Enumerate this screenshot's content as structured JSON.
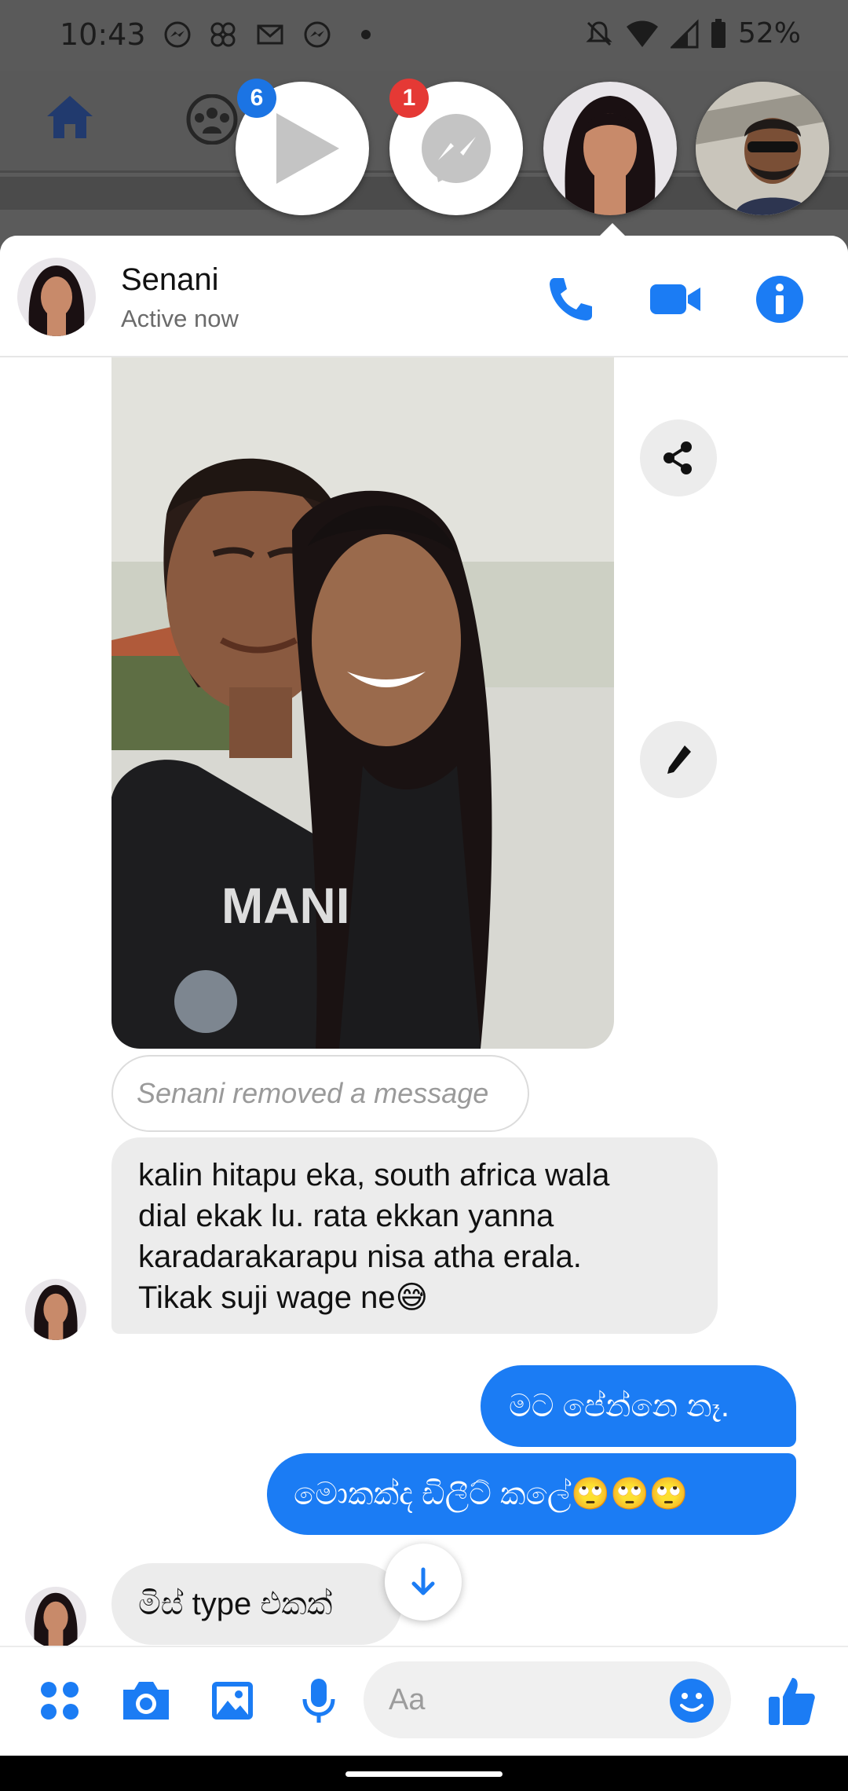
{
  "status_bar": {
    "time": "10:43",
    "battery": "52%",
    "icons": [
      "messenger-icon",
      "grid-icon",
      "mail-icon",
      "messenger-icon",
      "dot-icon"
    ],
    "right_icons": [
      "mute-icon",
      "wifi-icon",
      "signal-icon",
      "battery-icon"
    ]
  },
  "chat_heads": {
    "video_badge": "6",
    "messenger_badge": "1"
  },
  "conversation": {
    "name": "Senani",
    "status": "Active now"
  },
  "messages": {
    "removed": "Senani removed a message",
    "incoming_1": [
      "kalin hitapu eka, south africa wala",
      "dial ekak lu. rata ekkan yanna",
      "karadarakarapu nisa atha erala.",
      "Tikak suji wage ne😅"
    ],
    "outgoing_1": "මට පේන්නෙ නෑ.",
    "outgoing_2": "මොකක්ද ඩිලීට් කලේ🙄🙄🙄",
    "incoming_2": "මිස් type එකක්"
  },
  "composer": {
    "placeholder": "Aa"
  },
  "colors": {
    "accent": "#1b7cf4",
    "incoming_bubble": "#ececec",
    "badge_blue": "#1b74e4",
    "badge_red": "#e53935"
  }
}
